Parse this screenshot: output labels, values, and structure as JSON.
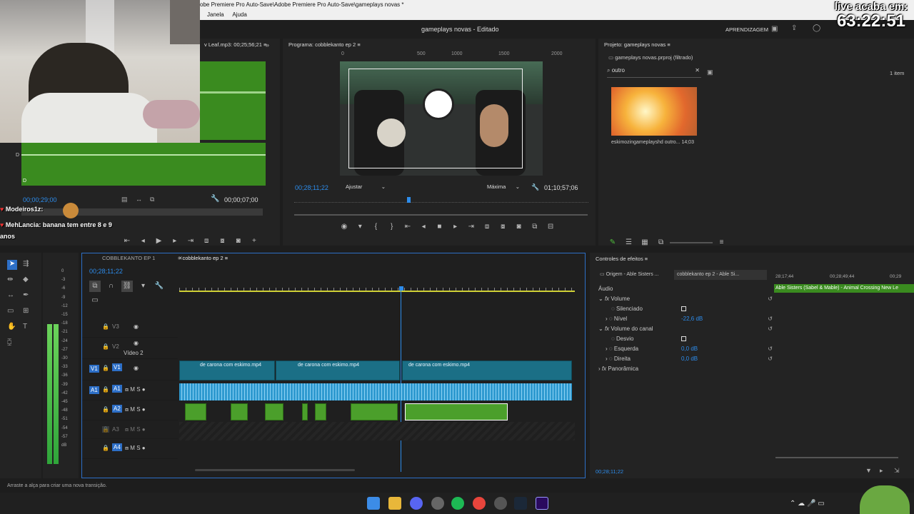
{
  "window_title": "obe Premiere Pro Auto-Save\\Adobe Premiere Pro Auto-Save\\gameplays novas *",
  "menu": [
    "Janela",
    "Ajuda"
  ],
  "workspace": {
    "project_title": "gameplays novas - Editado",
    "learning": "APRENDIZAGEM"
  },
  "overlay": {
    "live_label": "live acaba em:",
    "countdown": "63:22:51"
  },
  "chat": [
    {
      "user": "Modeiros1z:",
      "text": ""
    },
    {
      "user": "MehLancia:",
      "text": "banana tem entre 8 e 9"
    },
    {
      "user": "",
      "text": "anos"
    }
  ],
  "source_monitor": {
    "title": "v Leaf.mp3: 00;25;56;21",
    "timecode_left": "00;00;29;00",
    "timecode_right": "00;00;07;00",
    "label_d": "D"
  },
  "program_monitor": {
    "title": "Programa: cobblekanto ep 2",
    "ruler": [
      "0",
      "500",
      "1000",
      "1500",
      "2000"
    ],
    "timecode": "00;28;11;22",
    "fit": "Ajustar",
    "quality": "Máxima",
    "duration": "01;10;57;06"
  },
  "project_panel": {
    "title": "Projeto: gameplays novas",
    "filter_label": "gameplays novas.prproj (filtrado)",
    "search_value": "outro",
    "count": "1 item",
    "item_name": "eskimozingameplayshd outro...",
    "item_duration": "14;03"
  },
  "timeline": {
    "tabs": [
      "COBBLEKANTO EP 1",
      "cobblekanto ep 2"
    ],
    "timecode": "00;28;11;22",
    "tracks": [
      {
        "name": "V3"
      },
      {
        "name": "V2",
        "label": "Vídeo 2"
      },
      {
        "name": "V1"
      },
      {
        "name": "A1"
      },
      {
        "name": "A2"
      },
      {
        "name": "A3"
      },
      {
        "name": "A4"
      }
    ],
    "clips": [
      "de carona com eskimo.mp4",
      "de carona com eskimo.mp4",
      "de carona com eskimo.mp4"
    ],
    "meter_labels": [
      "0",
      "-3",
      "-6",
      "-9",
      "-12",
      "-15",
      "-18",
      "-21",
      "-24",
      "-27",
      "-30",
      "-33",
      "-36",
      "-39",
      "-42",
      "-45",
      "-48",
      "-51",
      "-54",
      "-57",
      "dB"
    ]
  },
  "effect_controls": {
    "title": "Controles de efeitos",
    "source_tab": "Origem - Able Sisters ...",
    "seq_tab": "cobblekanto ep 2 - Able Si...",
    "times": [
      "28;17;44",
      "00;28;49;44",
      "00;29"
    ],
    "clip_label": "Able Sisters (Sabel & Mable) - Animal Crossing New Le",
    "section": "Áudio",
    "volume": "Volume",
    "mute": "Silenciado",
    "level_label": "Nível",
    "level_value": "-22,6 dB",
    "channel_volume": "Volume do canal",
    "bypass": "Desvio",
    "left_label": "Esquerda",
    "left_value": "0,0 dB",
    "right_label": "Direita",
    "right_value": "0,0 dB",
    "panner": "Panorâmica",
    "footer_timecode": "00;28;11;22"
  },
  "status": "Arraste a alça para criar uma nova transição."
}
